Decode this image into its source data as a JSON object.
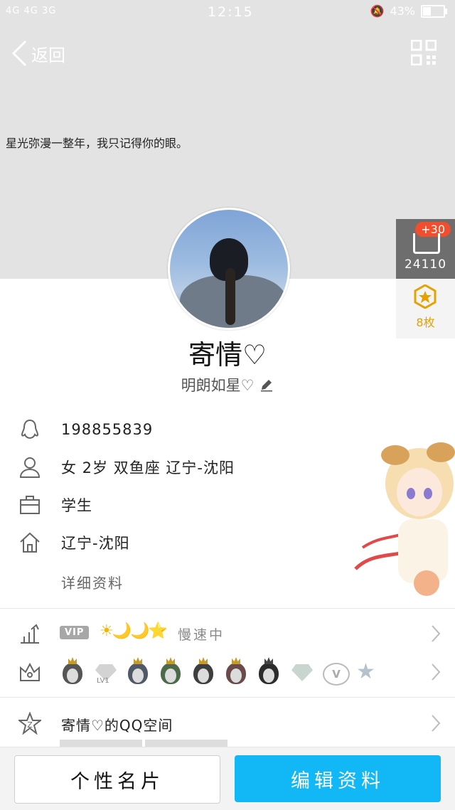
{
  "status_bar": {
    "signal_text": "4G 4G 3G",
    "time": "12:15",
    "battery_text": "43%",
    "battery_level": 0.43
  },
  "nav": {
    "back_label": "返回"
  },
  "profile": {
    "signature": "星光弥漫一整年，我只记得你的眼。",
    "likes_plus": "+30",
    "likes_count": "24110",
    "medals_count": "8枚",
    "nickname": "寄情♡",
    "remark": "明朗如星♡",
    "qq_number": "198855839",
    "basic_info": "女  2岁  双鱼座  辽宁-沈阳",
    "occupation": "学生",
    "hometown": "辽宁-沈阳",
    "details_link": "详细资料"
  },
  "rows": {
    "vip_badge": "VIP",
    "vip_level_icons": "☀🌙🌙⭐",
    "vip_status": "慢速中",
    "space_label": "寄情♡的QQ空间"
  },
  "badges": [
    "penguin-grey",
    "diamond-lv1",
    "penguin-blue",
    "penguin-green",
    "penguin-dark",
    "penguin-red",
    "penguin-crown",
    "diamond-grey",
    "vip-v",
    "star-grey"
  ],
  "badge_lv_text": "LV1",
  "buttons": {
    "card": "个性名片",
    "edit": "编辑资料"
  },
  "colors": {
    "accent": "#12b7f5",
    "plus_badge": "#f24e2d",
    "medal": "#e3a200"
  }
}
